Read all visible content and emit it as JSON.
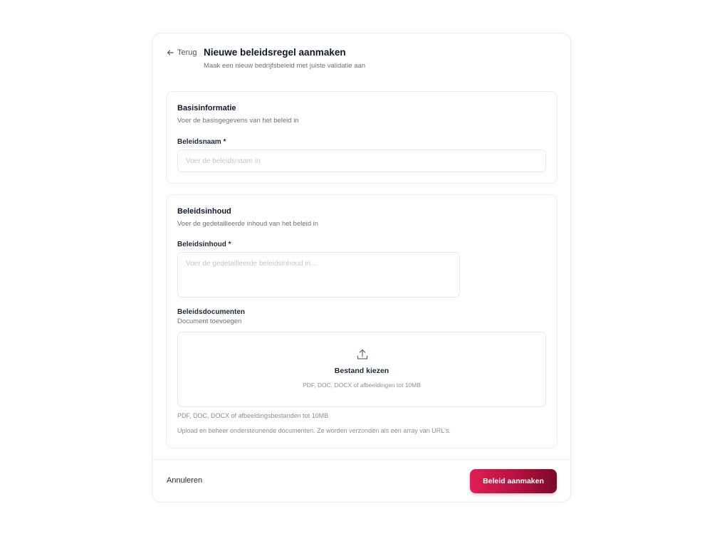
{
  "header": {
    "back_label": "Terug",
    "title": "Nieuwe beleidsregel aanmaken",
    "subtitle": "Maak een nieuw bedrijfsbeleid met juiste validatie aan"
  },
  "basic": {
    "title": "Basisinformatie",
    "description": "Voer de basisgegevens van het beleid in",
    "name_label": "Beleidsnaam *",
    "name_placeholder": "Voer de beleidsnaam in",
    "name_value": ""
  },
  "content": {
    "title": "Beleidsinhoud",
    "description": "Voer de gedetailleerde inhoud van het beleid in",
    "content_label": "Beleidsinhoud *",
    "content_placeholder": "Voer de gedetailleerde beleidsinhoud in...",
    "content_value": "",
    "docs_label": "Beleidsdocumenten",
    "docs_sublabel": "Document toevoegen",
    "dropzone_icon": "upload-icon",
    "dropzone_action": "Bestand kiezen",
    "dropzone_hint": "PDF, DOC, DOCX of afbeeldingen tot 10MB",
    "help_formats": "PDF, DOC, DOCX of afbeeldingsbestanden tot 10MB",
    "help_upload": "Upload en beheer ondersteunende documenten. Ze worden verzonden als een array van URL's."
  },
  "footer": {
    "cancel_label": "Annuleren",
    "submit_label": "Beleid aanmaken"
  },
  "colors": {
    "accent_start": "#e11d55",
    "accent_end": "#7a0a2a"
  }
}
